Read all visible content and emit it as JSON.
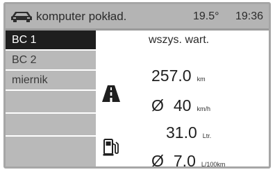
{
  "header": {
    "title": "komputer pokład.",
    "temperature": "19.5°",
    "time": "19:36",
    "icon": "car-icon"
  },
  "menu": {
    "items": [
      {
        "label": "BC 1",
        "selected": true
      },
      {
        "label": "BC 2",
        "selected": false
      },
      {
        "label": "miernik",
        "selected": false
      },
      {
        "label": "",
        "selected": false
      },
      {
        "label": "",
        "selected": false
      },
      {
        "label": "",
        "selected": false
      }
    ]
  },
  "content": {
    "title": "wszys. wart.",
    "distance": {
      "value": "257.0",
      "unit": "km",
      "icon": "road-icon"
    },
    "avg_speed": {
      "symbol": "Ø",
      "value": "40",
      "unit": "km/h"
    },
    "fuel_used": {
      "value": "31.0",
      "unit": "Ltr.",
      "icon": "fuel-pump-icon"
    },
    "avg_consumption": {
      "symbol": "Ø",
      "value": "7.0",
      "unit": "L/100km"
    }
  },
  "colors": {
    "header_bg": "#b4b4b4",
    "menu_bg": "#b9b9b9",
    "selected_bg": "#1e1e1e",
    "frame": "#a6a6a6"
  }
}
